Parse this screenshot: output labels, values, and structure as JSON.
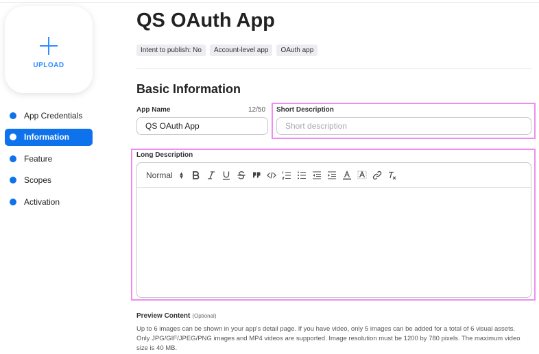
{
  "upload": {
    "label": "UPLOAD"
  },
  "nav": {
    "items": [
      {
        "label": "App Credentials",
        "active": false
      },
      {
        "label": "Information",
        "active": true
      },
      {
        "label": "Feature",
        "active": false
      },
      {
        "label": "Scopes",
        "active": false
      },
      {
        "label": "Activation",
        "active": false
      }
    ]
  },
  "header": {
    "title": "QS OAuth App",
    "tags": [
      "Intent to publish: No",
      "Account-level app",
      "OAuth app"
    ]
  },
  "basic_info": {
    "section_title": "Basic Information",
    "app_name": {
      "label": "App Name",
      "count": "12/50",
      "value": "QS OAuth App"
    },
    "short_description": {
      "label": "Short Description",
      "placeholder": "Short description",
      "value": ""
    },
    "long_description": {
      "label": "Long Description",
      "format_value": "Normal",
      "toolbar_icons": [
        "bold-icon",
        "italic-icon",
        "underline-icon",
        "strike-icon",
        "quote-icon",
        "code-icon",
        "ordered-list-icon",
        "bullet-list-icon",
        "outdent-icon",
        "indent-icon",
        "text-color-icon",
        "background-color-icon",
        "link-icon",
        "clear-format-icon"
      ]
    }
  },
  "preview": {
    "label": "Preview Content",
    "optional": "(Optional)",
    "description": "Up to 6 images can be shown in your app's detail page. If you have video, only 5 images can be added for a total of 6 visual assets. Only JPG/GIF/JPEG/PNG images and MP4 videos are supported. Image resolution must be 1200 by 780 pixels. The maximum video size is 40 MB."
  },
  "colors": {
    "accent": "#0e72ed",
    "upload_accent": "#2d8cff",
    "highlight": "#f08cf0"
  }
}
